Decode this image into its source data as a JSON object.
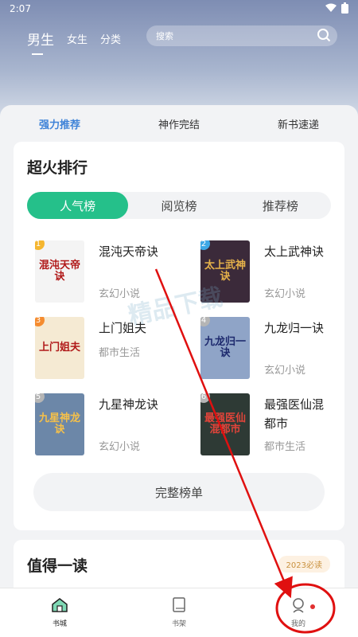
{
  "status": {
    "time": "2:07"
  },
  "top_nav": {
    "tabs": [
      "男生",
      "女生",
      "分类"
    ],
    "active": 0
  },
  "search": {
    "placeholder": "搜索"
  },
  "sub_tabs": [
    "强力推荐",
    "神作完结",
    "新书速递"
  ],
  "ranking": {
    "title": "超火排行",
    "segments": [
      "人气榜",
      "阅览榜",
      "推荐榜"
    ],
    "books": [
      {
        "rank": "1",
        "title": "混沌天帝诀",
        "genre": "玄幻小说",
        "cover_text": "混沌天帝诀",
        "cover_bg": "#f4f4f4",
        "rank_color": "#f5b62f"
      },
      {
        "rank": "2",
        "title": "太上武神诀",
        "genre": "玄幻小说",
        "cover_text": "太上武神诀",
        "cover_bg": "#3b2a3a",
        "rank_color": "#3fa8e6"
      },
      {
        "rank": "3",
        "title": "上门姐夫",
        "genre": "都市生活",
        "cover_text": "上门姐夫",
        "cover_bg": "#f5ead3",
        "rank_color": "#f58c2f"
      },
      {
        "rank": "4",
        "title": "九龙归一诀",
        "genre": "玄幻小说",
        "cover_text": "九龙归一诀",
        "cover_bg": "#8fa4c7",
        "rank_color": "#b5b5b5"
      },
      {
        "rank": "5",
        "title": "九星神龙诀",
        "genre": "玄幻小说",
        "cover_text": "九星神龙诀",
        "cover_bg": "#6c87a8",
        "rank_color": "#b5b5b5"
      },
      {
        "rank": "6",
        "title": "最强医仙混都市",
        "genre": "都市生活",
        "cover_text": "最强医仙混都市",
        "cover_bg": "#2e3a35",
        "rank_color": "#b5b5b5"
      }
    ],
    "full_button": "完整榜单"
  },
  "worth_reading": {
    "title": "值得一读",
    "badge": "2023必读"
  },
  "bottom_nav": [
    "书城",
    "书架",
    "我的"
  ],
  "watermark": "精品下载",
  "colors": {
    "accent_green": "#25c08a",
    "accent_blue": "#3f83d8",
    "annotation_red": "#e01010"
  }
}
